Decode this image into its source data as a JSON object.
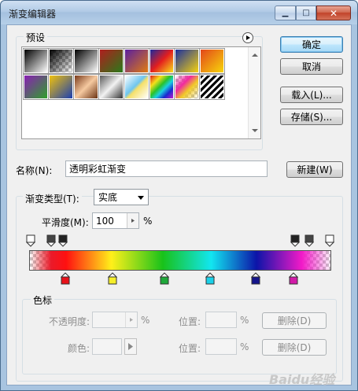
{
  "window": {
    "title": "渐变编辑器"
  },
  "titlebar_buttons": {
    "minimize": "▁",
    "maximize": "□",
    "close": "✕"
  },
  "presets": {
    "label": "预设",
    "swatches_row1": [
      "linear-gradient(135deg,#000 0%,#fff 100%)",
      "checker-black",
      "linear-gradient(135deg,#000 0%,#fff 100%)",
      "linear-gradient(135deg,#b01e1e 0%,#2a7a1a 100%)",
      "linear-gradient(135deg,#5a1fa0 0%,#e07b12 100%)",
      "linear-gradient(135deg,#1b2a9e 0%,#e41e1e 50%,#f7e01a 100%)",
      "linear-gradient(135deg,#1a2fa0 0%,#f5d20e 100%)",
      "linear-gradient(135deg,#e3461a 0%,#f7d60b 100%)"
    ],
    "swatches_row2": [
      "linear-gradient(135deg,#8a1fb5 0%,#2fa02a 100%)",
      "linear-gradient(135deg,#f1c20c 0%,#1c3fb0 100%)",
      "linear-gradient(135deg,#7a3a1a 0%,#f5c9a0 50%,#6b3313 100%)",
      "linear-gradient(135deg,#5a5a5a 0%,#f2f2f2 50%,#333 100%)",
      "linear-gradient(135deg,#fff 0%,#6ec5ef 45%,#f5e06a 55%,#fff 100%)",
      "linear-gradient(135deg,#e01b1b 0%,#f5e01a 25%,#2ac22a 45%,#1ad0e0 60%,#1a2ad0 78%,#c21ad0 100%)",
      "checker-rainbow",
      "stripes"
    ]
  },
  "buttons": {
    "ok": "确定",
    "cancel": "取消",
    "load": "载入(L)...",
    "save": "存储(S)...",
    "new": "新建(W)",
    "delete1": "删除(D)",
    "delete2": "删除(D)"
  },
  "name_row": {
    "label": "名称(N):",
    "value": "透明彩虹渐变"
  },
  "gradient": {
    "type_label": "渐变类型(T):",
    "type_value": "实底",
    "smooth_label": "平滑度(M):",
    "smooth_value": "100",
    "smooth_unit": "%"
  },
  "color_stop": {
    "group_label": "色标",
    "opacity_label": "不透明度:",
    "opacity_unit": "%",
    "position_label_1": "位置:",
    "position_unit_1": "%",
    "color_label": "颜色:",
    "position_label_2": "位置:",
    "position_unit_2": "%"
  },
  "colors": {
    "stops": [
      "#e8121a",
      "#f5ee2a",
      "#1fa83a",
      "#1ad0e8",
      "#14148a",
      "#d21aa8"
    ]
  },
  "watermark": "Baidu经验"
}
